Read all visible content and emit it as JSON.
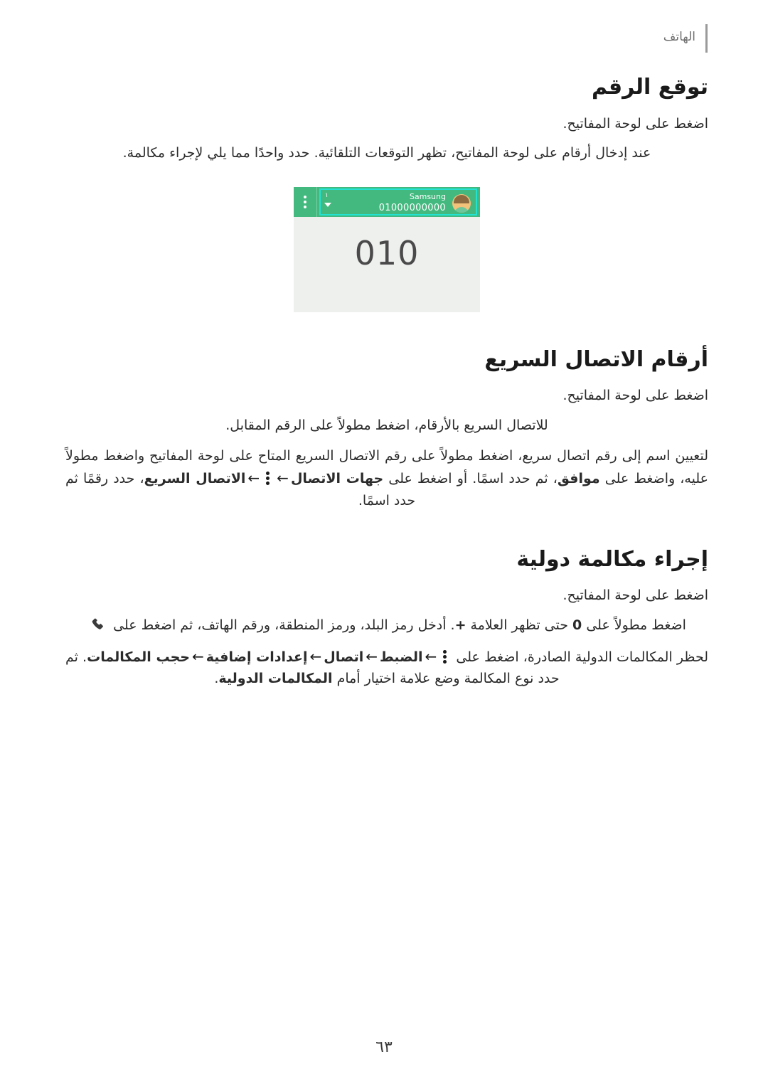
{
  "header": {
    "chapter_title": "الهاتف"
  },
  "sections": [
    {
      "title": "توقع الرقم",
      "lead": "اضغط على لوحة المفاتيح.",
      "paragraphs": [
        "عند إدخال أرقام على لوحة المفاتيح، تظهر التوقعات التلقائية. حدد واحدًا مما يلي لإجراء مكالمة."
      ]
    },
    {
      "title": "أرقام الاتصال السريع",
      "lead": "اضغط على لوحة المفاتيح.",
      "paragraphs": [
        "للاتصال السريع بالأرقام، اضغط مطولاً على الرقم المقابل.",
        "لتعيين اسم إلى رقم اتصال سريع، اضغط مطولاً على رقم الاتصال السريع المتاح على لوحة المفاتيح واضغط مطولاً عليه، واضغط على موافق، ثم حدد اسمًا. أو اضغط على جهات الاتصال ← ⋮ ← الاتصال السريع، حدد رقمًا ثم حدد اسمًا."
      ]
    },
    {
      "title": "إجراء مكالمة دولية",
      "lead": "اضغط على لوحة المفاتيح.",
      "paragraphs": [
        "اضغط مطولاً على 0 حتى تظهر العلامة +. أدخل رمز البلد، ورمز المنطقة، ورقم الهاتف، ثم اضغط على",
        "لحظر المكالمات الدولية الصادرة، اضغط على ⋮ ← الضبط ← اتصال ← إعدادات إضافية ← حجب المكالمات. ثم حدد نوع المكالمة وضع علامة اختيار أمام المكالمات الدولية."
      ]
    }
  ],
  "phone_screenshot": {
    "contact_name": "Samsung",
    "contact_number": "01000000000",
    "badge": "١",
    "dialed_digits": "010",
    "accent_color": "#43b97f",
    "highlight_color": "#22e2d2"
  },
  "page_number": "٦٣"
}
